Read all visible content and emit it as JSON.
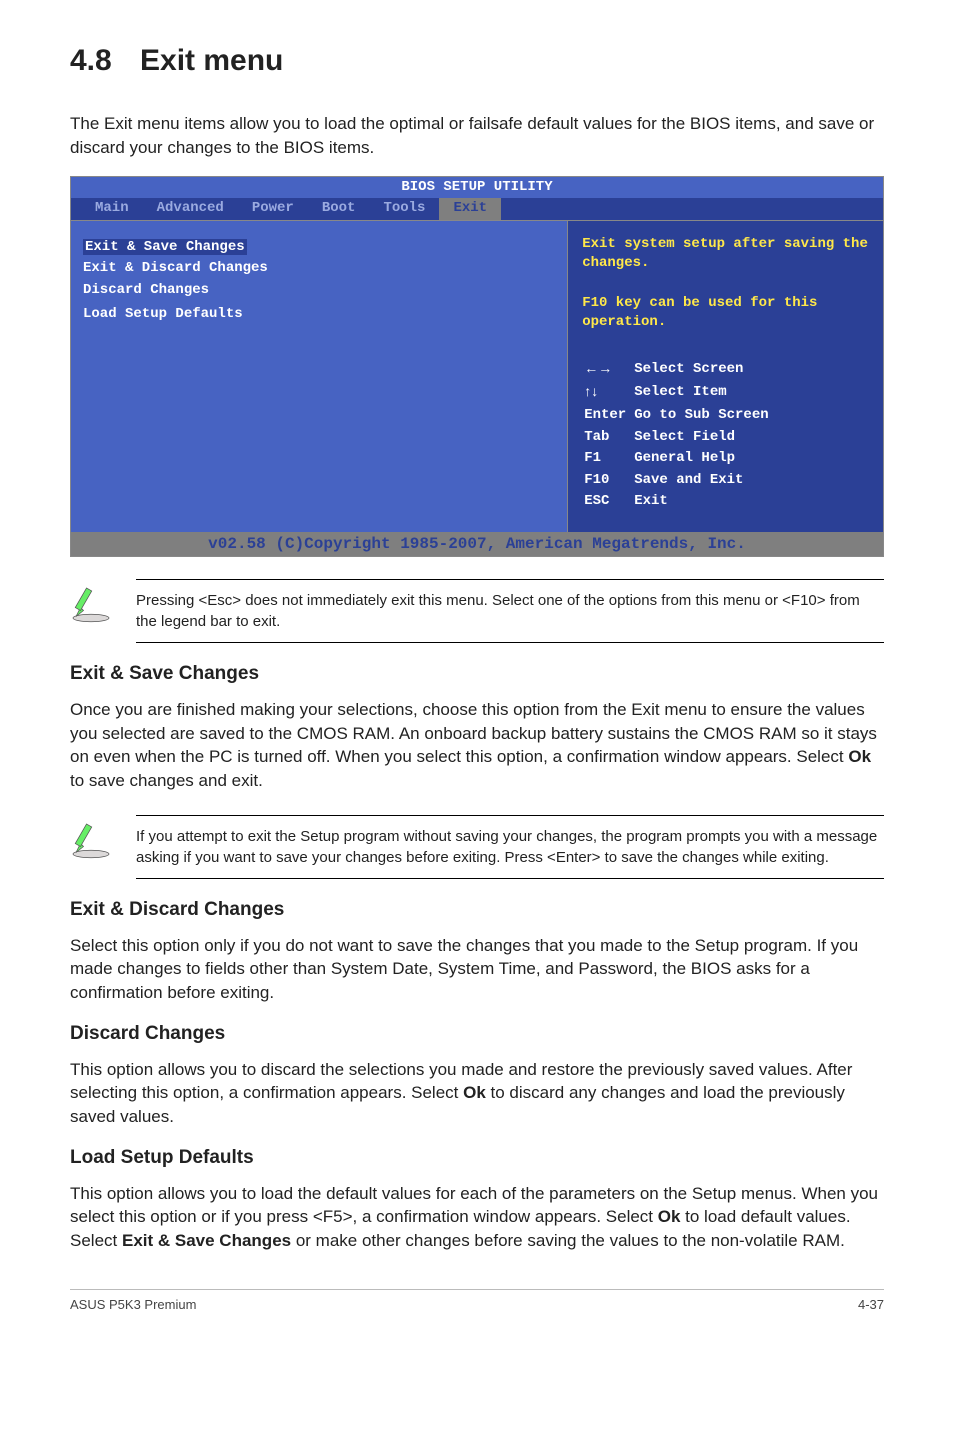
{
  "section": {
    "number": "4.8",
    "title": "Exit menu",
    "intro": "The Exit menu items allow you to load the optimal or failsafe default values for the BIOS items, and save or discard your changes to the BIOS items."
  },
  "bios": {
    "header": "BIOS SETUP UTILITY",
    "menu": [
      "Main",
      "Advanced",
      "Power",
      "Boot",
      "Tools",
      "Exit"
    ],
    "active_tab": "Exit",
    "items": [
      "Exit & Save Changes",
      "Exit & Discard Changes",
      "Discard Changes",
      "",
      "Load Setup Defaults"
    ],
    "help_top": [
      "Exit system setup after saving the changes.",
      "",
      "F10 key can be used for this operation."
    ],
    "keys_title_arrows_lr": "← →",
    "keys_title_arrows_ud": "↑ ↓",
    "keys": [
      [
        "←→",
        "Select Screen"
      ],
      [
        "↑↓",
        "Select Item"
      ],
      [
        "Enter",
        "Go to Sub Screen"
      ],
      [
        "Tab",
        "Select Field"
      ],
      [
        "F1",
        "General Help"
      ],
      [
        "F10",
        "Save and Exit"
      ],
      [
        "ESC",
        "Exit"
      ]
    ],
    "footer": "v02.58 (C)Copyright 1985-2007, American Megatrends, Inc."
  },
  "esc_note": "Pressing <Esc> does not immediately exit this menu. Select one of the options from this menu or <F10> from the legend bar to exit.",
  "save": {
    "title": "Exit & Save Changes",
    "body_pre": "Once you are finished making your selections, choose this option from the Exit menu to ensure the values you selected are saved to the CMOS RAM. An onboard backup battery sustains the CMOS RAM so it stays on even when the PC is turned off. When you select this option, a confirmation window appears. Select ",
    "body_bold": "Ok",
    "body_post": " to save changes and exit."
  },
  "save_note": "If you attempt to exit the Setup program without saving your changes, the program prompts you with a message asking if you want to save your changes before exiting. Press <Enter> to save the changes while exiting.",
  "discard": {
    "title": "Exit & Discard Changes",
    "body": "Select this option only if you do not want to save the changes that you  made to the Setup program. If you made changes to fields other than System Date, System Time, and Password, the BIOS asks for a confirmation before exiting."
  },
  "discard_only": {
    "title": "Discard Changes",
    "body_pre": "This option allows you to discard the selections you made and restore the previously saved values. After selecting this option, a confirmation appears. Select ",
    "body_bold": "Ok",
    "body_post": " to discard any changes and load the previously saved values."
  },
  "defaults": {
    "title": "Load Setup Defaults",
    "body_1": "This option allows you to load the default values for each of the parameters on the Setup menus. When you select this option or if you press <F5>, a confirmation window appears. Select ",
    "body_b1": "Ok",
    "body_2": " to load default values. Select ",
    "body_b2": "Exit & Save Changes",
    "body_3": " or make other changes before saving the values to the non-volatile RAM."
  },
  "footer": {
    "left": "ASUS P5K3 Premium",
    "right": "4-37"
  }
}
